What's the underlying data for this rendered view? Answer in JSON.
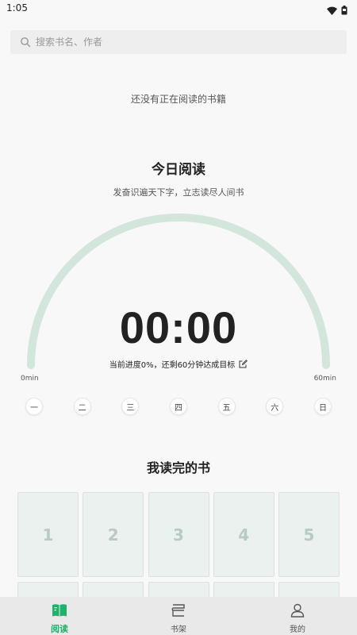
{
  "status_bar": {
    "time": "1:05",
    "icons": [
      "wifi-icon",
      "battery-icon"
    ]
  },
  "search": {
    "placeholder": "搜索书名、作者",
    "icon": "search-icon"
  },
  "reading": {
    "empty_text": "还没有正在阅读的书籍"
  },
  "today": {
    "title": "今日阅读",
    "subtitle": "发奋识遍天下字，立志读尽人间书",
    "timer": "00:00",
    "progress_text": "当前进度0%，还剩60分钟达成目标",
    "progress_fraction": 0,
    "min_label_start": "0min",
    "min_label_end": "60min",
    "weekdays": [
      "一",
      "二",
      "三",
      "四",
      "五",
      "六",
      "日"
    ]
  },
  "finished": {
    "title": "我读完的书",
    "slots": [
      "1",
      "2",
      "3",
      "4",
      "5",
      "",
      "",
      "",
      "",
      ""
    ]
  },
  "tabbar": {
    "tabs": [
      {
        "label": "阅读",
        "icon": "book-open-icon",
        "active": true
      },
      {
        "label": "书架",
        "icon": "bookshelf-icon",
        "active": false
      },
      {
        "label": "我的",
        "icon": "user-icon",
        "active": false
      }
    ]
  },
  "colors": {
    "accent": "#1fb26a",
    "gauge_track": "#d3e6dc",
    "tile_bg": "#eaf1ee"
  }
}
